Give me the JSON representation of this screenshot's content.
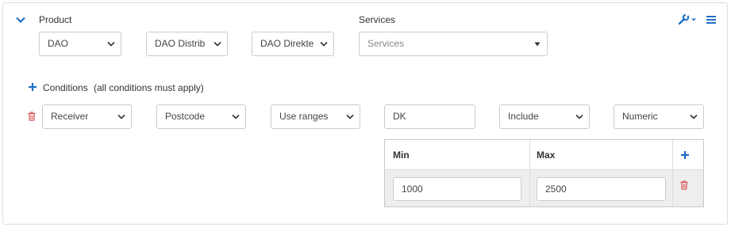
{
  "product": {
    "label": "Product",
    "selects": [
      "DAO",
      "DAO Distrib",
      "DAO Direkte"
    ]
  },
  "services": {
    "label": "Services",
    "placeholder": "Services"
  },
  "conditions": {
    "title": "Conditions",
    "note": "(all conditions must apply)",
    "row": {
      "field": "Receiver",
      "attribute": "Postcode",
      "mode": "Use ranges",
      "value": "DK",
      "action": "Include",
      "type": "Numeric"
    },
    "ranges": {
      "min_header": "Min",
      "max_header": "Max",
      "rows": [
        {
          "min": "1000",
          "max": "2500"
        }
      ]
    }
  },
  "colors": {
    "accent": "#1f6fc5",
    "danger": "#d9534f",
    "border": "#cccccc"
  }
}
